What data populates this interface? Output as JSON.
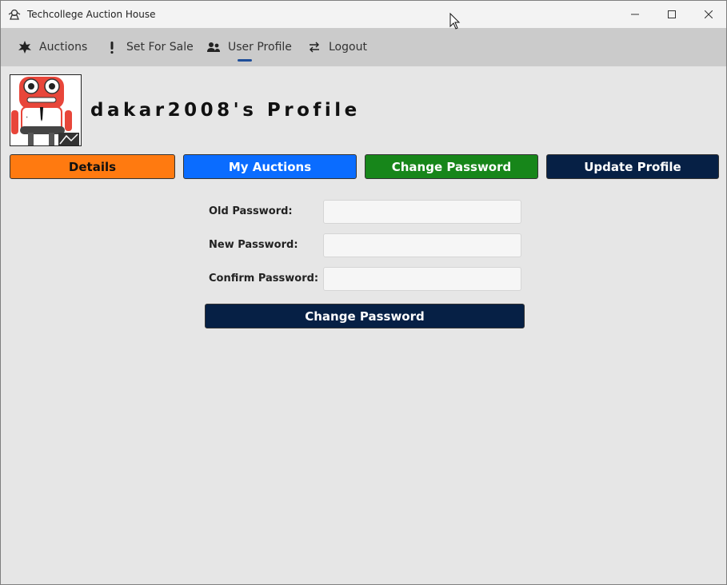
{
  "window": {
    "title": "Techcollege Auction House",
    "icons": {
      "app": "auction-house-icon",
      "minimize": "minimize-icon",
      "maximize": "maximize-icon",
      "close": "close-icon"
    }
  },
  "nav": {
    "items": [
      {
        "label": "Auctions",
        "icon": "auctions-icon"
      },
      {
        "label": "Set For Sale",
        "icon": "exclamation-icon"
      },
      {
        "label": "User Profile",
        "icon": "users-icon",
        "active": true
      },
      {
        "label": "Logout",
        "icon": "swap-arrows-icon"
      }
    ]
  },
  "profile": {
    "title": "dakar2008's Profile",
    "avatar_icon": "robot-avatar"
  },
  "tabs": {
    "details": "Details",
    "my_auctions": "My Auctions",
    "change_password": "Change Password",
    "update_profile": "Update Profile"
  },
  "form": {
    "old_password_label": "Old Password:",
    "old_password_value": "",
    "new_password_label": "New Password:",
    "new_password_value": "",
    "confirm_password_label": "Confirm Password:",
    "confirm_password_value": "",
    "submit_label": "Change Password"
  },
  "colors": {
    "details": "#ff7a10",
    "my_auctions": "#0a6cff",
    "change_password": "#17861a",
    "update_profile": "#062045",
    "nav_indicator": "#1f4e99"
  }
}
